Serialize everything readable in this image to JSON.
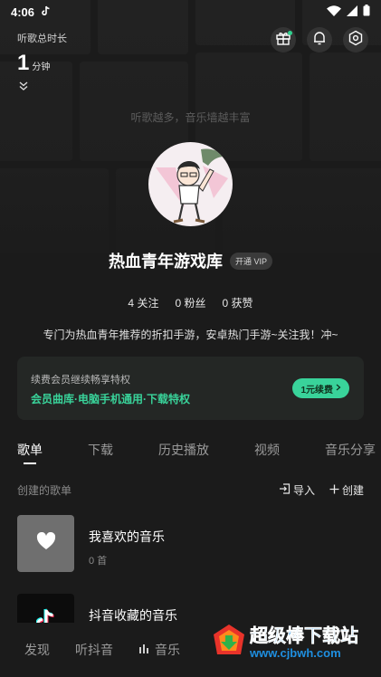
{
  "status_bar": {
    "time": "4:06"
  },
  "listen_stats": {
    "label": "听歌总时长",
    "value": "1",
    "unit": "分钟"
  },
  "wall_text": "听歌越多，音乐墙越丰富",
  "profile": {
    "name": "热血青年游戏库",
    "vip_badge": "开通 VIP",
    "stats": [
      {
        "count": "4",
        "label": "关注"
      },
      {
        "count": "0",
        "label": "粉丝"
      },
      {
        "count": "0",
        "label": "获赞"
      }
    ],
    "bio": "专门为热血青年推荐的折扣手游，安卓热门手游~关注我！冲~"
  },
  "vip_card": {
    "title": "续费会员继续畅享特权",
    "subtitle": "会员曲库·电脑手机通用·下载特权",
    "button": "1元续费"
  },
  "tabs": [
    "歌单",
    "下载",
    "历史播放",
    "视频",
    "音乐分享"
  ],
  "section": {
    "title": "创建的歌单",
    "import_label": "导入",
    "create_label": "创建"
  },
  "playlists": [
    {
      "name": "我喜欢的音乐",
      "count": "0 首"
    },
    {
      "name": "抖音收藏的音乐",
      "count": ""
    }
  ],
  "bottom_nav": {
    "discover": "发现",
    "listen_douyin": "听抖音",
    "music": "音乐"
  },
  "watermark": {
    "title": "超级棒下载站",
    "url": "www.cjbwh.com"
  },
  "colors": {
    "accent": "#39d39a",
    "background": "#1b1b1b",
    "watermark_blue": "#1f8fe0"
  }
}
